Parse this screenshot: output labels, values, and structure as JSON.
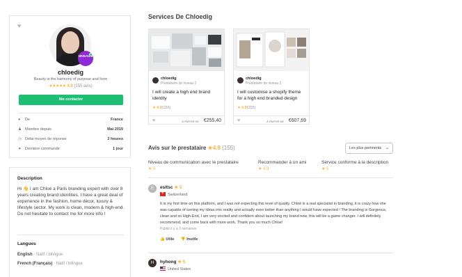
{
  "profile": {
    "username": "chloedig",
    "level_badge": "NIVEAU 2",
    "tagline": "Beauty is the harmony of purpose and form",
    "stars": "★★★★★",
    "rating": "4.9",
    "rating_count": "(155 avis)",
    "contact_label": "Me contacter",
    "stats": [
      {
        "icon": "location-pin-icon",
        "glyph": "●",
        "label": "De",
        "value": "France"
      },
      {
        "icon": "user-icon",
        "glyph": "♟",
        "label": "Membre depuis",
        "value": "Mai 2019"
      },
      {
        "icon": "clock-icon",
        "glyph": "◷",
        "label": "Délai moyen de réponse",
        "value": "2 heures"
      },
      {
        "icon": "send-icon",
        "glyph": "➤",
        "label": "Dernière commande",
        "value": "1 jour"
      }
    ]
  },
  "description": {
    "title": "Description",
    "body": "Hi 👋 I am Chloé a Paris branding expert with over 8 years creating brand identities. I have a great deal of experience in the fashion, home décor, luxury & lifestyle sector. My work is clean, modern & high-end. Do not hesitate to contact me for more info !",
    "languages_title": "Langues",
    "languages": [
      {
        "name": "English",
        "level": "- Natif / bilingue"
      },
      {
        "name": "French (Français)",
        "level": "- Natif / bilingue"
      }
    ]
  },
  "services": {
    "title": "Services De Chloedig",
    "gigs": [
      {
        "seller": "chloedig",
        "level": "Prestataire de niveau 2",
        "title": "I will create a high end brand identity",
        "star": "★",
        "rating": "4.9",
        "count": "(155)",
        "price_label": "À PARTIR DE",
        "price": "€255,40"
      },
      {
        "seller": "chloedig",
        "level": "Prestataire de niveau 2",
        "title": "I will customise a shopify theme for a high end branded design",
        "star": "★",
        "rating": "4.9",
        "count": "(155)",
        "price_label": "À PARTIR DE",
        "price": "€607,69"
      }
    ]
  },
  "reviews": {
    "title": "Avis sur le prestataire",
    "star": "★",
    "rating": "4.9",
    "count": "(155)",
    "sort_label": "Les plus pertinents",
    "breakdown": [
      {
        "label": "Niveau de communication avec le prestataire",
        "value": "★ 5"
      },
      {
        "label": "Recommander à un ami",
        "value": "★ 4.9"
      },
      {
        "label": "Service conforme à la description",
        "value": "★ 5"
      }
    ],
    "items": [
      {
        "initial": "E",
        "name": "esltsc",
        "score": "★ 5",
        "country": "Switzerland",
        "text": "It is my first time on this platform, and I was not expecting this level of quality. Chloé is a real specialist in branding, it is crazy how she was capable of turning my ideas into reality and actually even better than anything I would have expected ! The branding is Gorgeous, clean and so High-End, I am very excited and confident about launching my brand now, this will be a game changer. I will definitely recommend, and come back with more work. Thank you so much Chloe!",
        "time": "Publié il y a 3 semaines",
        "useful": "Utile",
        "useless": "Inutile"
      },
      {
        "initial": "H",
        "name": "hyhong",
        "score": "★ 5",
        "country": "United States"
      }
    ]
  }
}
